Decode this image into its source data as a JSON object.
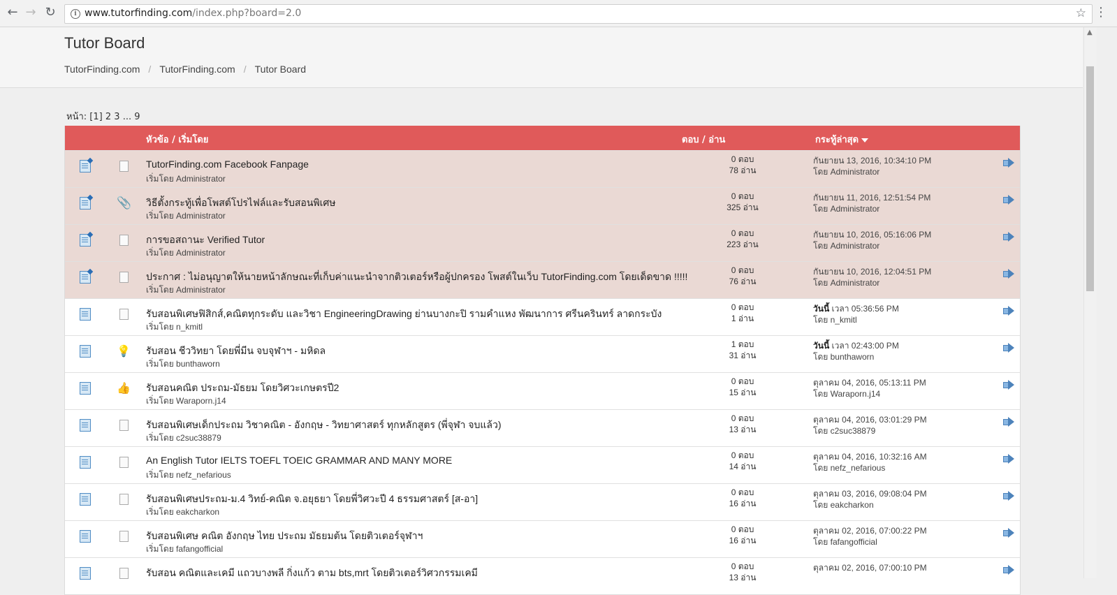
{
  "browser": {
    "url_domain": "www.tutorfinding.com",
    "url_path": "/index.php?board=2.0"
  },
  "header": {
    "title": "Tutor Board",
    "breadcrumb": [
      "TutorFinding.com",
      "TutorFinding.com",
      "Tutor Board"
    ]
  },
  "pagination": {
    "label": "หน้า:",
    "current": "[1]",
    "pages": [
      "2",
      "3"
    ],
    "ellipsis": "...",
    "last": "9"
  },
  "table": {
    "col_subject": "หัวข้อ / เริ่มโดย",
    "col_replies": "ตอบ / อ่าน",
    "col_last": "กระทู้ล่าสุด",
    "colors": {
      "header_bg": "#e05a5a",
      "sticky_bg": "#ead9d4"
    },
    "rows": [
      {
        "sticky": true,
        "icon": "document-icon",
        "subject": "TutorFinding.com Facebook Fanpage",
        "started": "เริ่มโดย Administrator",
        "replies": "0 ตอบ",
        "views": "78 อ่าน",
        "last_date": "กันยายน 13, 2016, 10:34:10 PM",
        "last_by": "โดย Administrator"
      },
      {
        "sticky": true,
        "icon": "paperclip-icon",
        "subject": "วิธีตั้งกระทู้เพื่อโพสต์โปรไฟล์และรับสอนพิเศษ",
        "started": "เริ่มโดย Administrator",
        "replies": "0 ตอบ",
        "views": "325 อ่าน",
        "last_date": "กันยายน 11, 2016, 12:51:54 PM",
        "last_by": "โดย Administrator"
      },
      {
        "sticky": true,
        "icon": "document-icon",
        "subject": "การขอสถานะ Verified Tutor",
        "started": "เริ่มโดย Administrator",
        "replies": "0 ตอบ",
        "views": "223 อ่าน",
        "last_date": "กันยายน 10, 2016, 05:16:06 PM",
        "last_by": "โดย Administrator"
      },
      {
        "sticky": true,
        "icon": "document-icon",
        "subject": "ประกาศ : ไม่อนุญาตให้นายหน้าลักษณะที่เก็บค่าแนะนำจากติวเตอร์หรือผู้ปกครอง โพสต์ในเว็บ TutorFinding.com โดยเด็ดขาด !!!!!",
        "started": "เริ่มโดย Administrator",
        "replies": "0 ตอบ",
        "views": "76 อ่าน",
        "last_date": "กันยายน 10, 2016, 12:04:51 PM",
        "last_by": "โดย Administrator"
      },
      {
        "sticky": false,
        "icon": "document-icon",
        "subject": "รับสอนพิเศษฟิสิกส์,คณิตทุกระดับ และวิชา EngineeringDrawing ย่านบางกะปิ รามคำแหง พัฒนาการ ศรีนครินทร์ ลาดกระบัง",
        "started": "เริ่มโดย n_kmitl",
        "replies": "0 ตอบ",
        "views": "1 อ่าน",
        "last_today": "วันนี้",
        "last_date": "เวลา 05:36:56 PM",
        "last_by": "โดย n_kmitl"
      },
      {
        "sticky": false,
        "icon": "lightbulb-icon",
        "subject": "รับสอน ชีววิทยา โดยพี่มีน จบจุฬาฯ - มหิดล",
        "started": "เริ่มโดย bunthaworn",
        "replies": "1 ตอบ",
        "views": "31 อ่าน",
        "last_today": "วันนี้",
        "last_date": "เวลา 02:43:00 PM",
        "last_by": "โดย bunthaworn"
      },
      {
        "sticky": false,
        "icon": "thumbs-up-icon",
        "subject": "รับสอนคณิต ประถม-มัธยม โดยวิศวะเกษตรปี2",
        "started": "เริ่มโดย Waraporn.j14",
        "replies": "0 ตอบ",
        "views": "15 อ่าน",
        "last_date": "ตุลาคม 04, 2016, 05:13:11 PM",
        "last_by": "โดย Waraporn.j14"
      },
      {
        "sticky": false,
        "icon": "document-icon",
        "subject": "รับสอนพิเศษเด็กประถม วิชาคณิต - อังกฤษ - วิทยาศาสตร์ ทุกหลักสูตร (พี่จุฬา จบแล้ว)",
        "started": "เริ่มโดย c2suc38879",
        "replies": "0 ตอบ",
        "views": "13 อ่าน",
        "last_date": "ตุลาคม 04, 2016, 03:01:29 PM",
        "last_by": "โดย c2suc38879"
      },
      {
        "sticky": false,
        "icon": "document-icon",
        "subject": "An English Tutor IELTS TOEFL TOEIC GRAMMAR AND MANY MORE",
        "started": "เริ่มโดย nefz_nefarious",
        "replies": "0 ตอบ",
        "views": "14 อ่าน",
        "last_date": "ตุลาคม 04, 2016, 10:32:16 AM",
        "last_by": "โดย nefz_nefarious"
      },
      {
        "sticky": false,
        "icon": "document-icon",
        "subject": "รับสอนพิเศษประถม-ม.4 วิทย์-คณิต จ.อยุธยา โดยพี่วิศวะปี 4 ธรรมศาสตร์ [ส-อา]",
        "started": "เริ่มโดย eakcharkon",
        "replies": "0 ตอบ",
        "views": "16 อ่าน",
        "last_date": "ตุลาคม 03, 2016, 09:08:04 PM",
        "last_by": "โดย eakcharkon"
      },
      {
        "sticky": false,
        "icon": "document-icon",
        "subject": "รับสอนพิเศษ คณิต อังกฤษ ไทย ประถม มัธยมต้น โดยติวเตอร์จุฬาฯ",
        "started": "เริ่มโดย fafangofficial",
        "replies": "0 ตอบ",
        "views": "16 อ่าน",
        "last_date": "ตุลาคม 02, 2016, 07:00:22 PM",
        "last_by": "โดย fafangofficial"
      },
      {
        "sticky": false,
        "icon": "document-icon",
        "subject": "รับสอน คณิตและเคมี แถวบางพลี กิ่งแก้ว ตาม bts,mrt โดยติวเตอร์วิศวกรรมเคมี",
        "started": "",
        "replies": "0 ตอบ",
        "views": "13 อ่าน",
        "last_date": "ตุลาคม 02, 2016, 07:00:10 PM",
        "last_by": ""
      }
    ]
  }
}
